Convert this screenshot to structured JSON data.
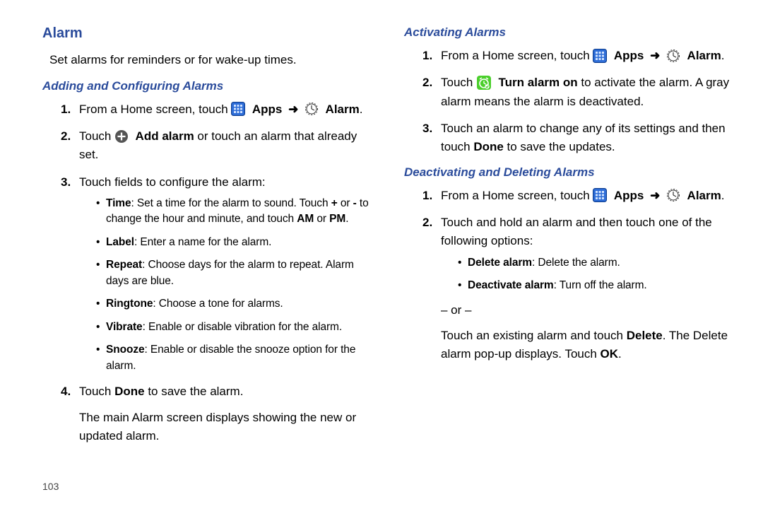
{
  "page_number": "103",
  "arrow_glyph": "➜",
  "left": {
    "title": "Alarm",
    "intro": "Set alarms for reminders or for wake-up times.",
    "sec1_title": "Adding and Configuring Alarms",
    "s1": {
      "n": "1.",
      "pre": "From a Home screen, touch ",
      "apps": "Apps",
      "alarm": "Alarm",
      "dot": "."
    },
    "s2": {
      "n": "2.",
      "pre": "Touch ",
      "add": "Add alarm",
      "post": " or touch an alarm that already set."
    },
    "s3": {
      "n": "3.",
      "text": "Touch fields to configure the alarm:",
      "b_time": "Time",
      "b_time_post": ": Set a time for the alarm to sound. Touch ",
      "b_time_plus": "+",
      "b_time_or": " or ",
      "b_time_minus": "-",
      "b_time_post2": " to change the hour and minute, and touch ",
      "b_time_am": "AM",
      "b_time_or2": " or ",
      "b_time_pm": "PM",
      "b_time_dot": ".",
      "b_label": "Label",
      "b_label_post": ": Enter a name for the alarm.",
      "b_repeat": "Repeat",
      "b_repeat_post": ": Choose days for the alarm to repeat. Alarm days are blue.",
      "b_ring": "Ringtone",
      "b_ring_post": ": Choose a tone for alarms.",
      "b_vib": "Vibrate",
      "b_vib_post": ": Enable or disable vibration for the alarm.",
      "b_sn": "Snooze",
      "b_sn_post": ": Enable or disable the snooze option for the alarm."
    },
    "s4": {
      "n": "4.",
      "pre": "Touch ",
      "done": "Done",
      "post": " to save the alarm.",
      "tail": "The main Alarm screen displays showing the new or updated alarm."
    }
  },
  "right": {
    "sec2_title": "Activating Alarms",
    "a1": {
      "n": "1.",
      "pre": "From a Home screen, touch ",
      "apps": "Apps",
      "alarm": "Alarm",
      "dot": "."
    },
    "a2": {
      "n": "2.",
      "pre": "Touch ",
      "turn": "Turn alarm on",
      "post": " to activate the alarm. A gray alarm means the alarm is deactivated."
    },
    "a3": {
      "n": "3.",
      "pre": "Touch an alarm to change any of its settings and then touch ",
      "done": "Done",
      "post": " to save the updates."
    },
    "sec3_title": "Deactivating and Deleting Alarms",
    "d1": {
      "n": "1.",
      "pre": "From a Home screen, touch ",
      "apps": "Apps",
      "alarm": "Alarm",
      "dot": "."
    },
    "d2": {
      "n": "2.",
      "text": "Touch and hold an alarm and then touch one of the following options:",
      "b_del": "Delete alarm",
      "b_del_post": ": Delete the alarm.",
      "b_de": "Deactivate alarm",
      "b_de_post": ": Turn off the alarm.",
      "or": "– or –",
      "tail_pre": "Touch an existing alarm and touch ",
      "tail_del": "Delete",
      "tail_mid": ". The Delete alarm pop-up displays. Touch ",
      "tail_ok": "OK",
      "tail_dot": "."
    }
  }
}
